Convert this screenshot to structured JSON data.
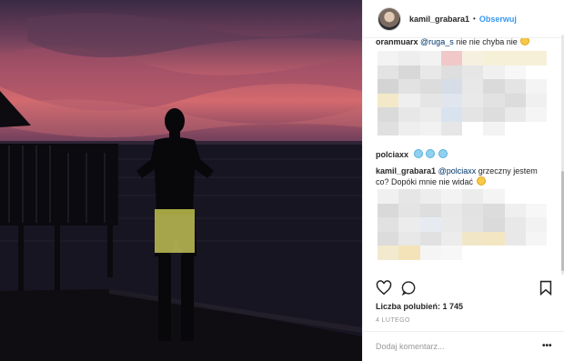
{
  "post": {
    "username": "kamil_grabara1",
    "follow_label": "Obserwuj",
    "dot": "•"
  },
  "comments": {
    "cut_text": "​",
    "cut_author": "oranmuarx",
    "cut_mention": "@ruga_s",
    "cut_rest": "nie nie chyba nie",
    "second_author": "polciaxx",
    "reply_author": "kamil_grabara1",
    "reply_mention": "@polciaxx",
    "reply_text": "grzeczny jestem co? Dopóki mnie nie widać"
  },
  "stats": {
    "likes": "Liczba polubień: 1 745",
    "date": "4 LUTEGO"
  },
  "add_comment": {
    "placeholder": "Dodaj komentarz...",
    "more": "•••"
  },
  "icons": [
    "heart-icon",
    "comment-icon",
    "bookmark-icon",
    "more-icon"
  ]
}
